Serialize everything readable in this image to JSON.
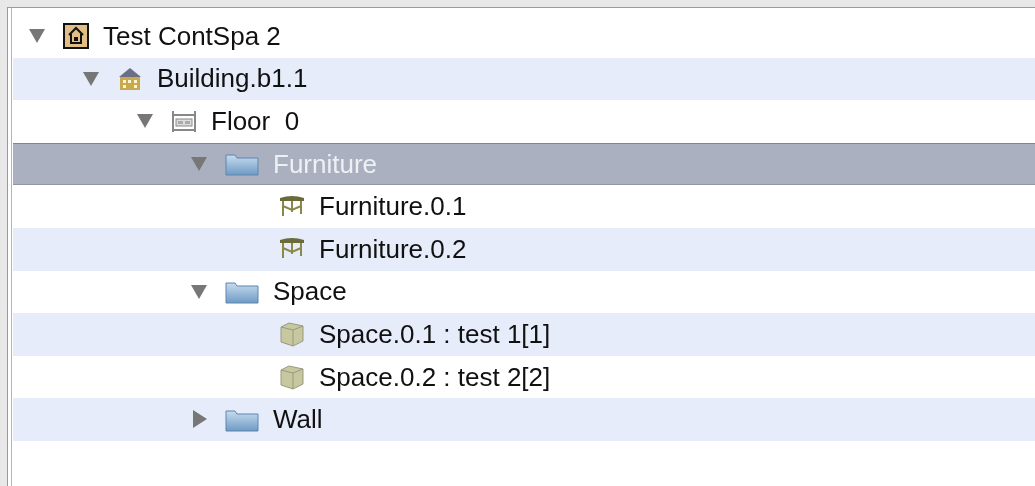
{
  "tree": [
    {
      "label": "Test ContSpa 2",
      "kind": "root",
      "expanded": true,
      "selected": false,
      "children": [
        {
          "label": "Building.b1.1",
          "kind": "building",
          "expanded": true,
          "selected": false,
          "children": [
            {
              "label": "Floor  0",
              "kind": "floor",
              "expanded": true,
              "selected": false,
              "children": [
                {
                  "label": "Furniture",
                  "kind": "folder",
                  "expanded": true,
                  "selected": true,
                  "children": [
                    {
                      "label": "Furniture.0.1",
                      "kind": "furniture",
                      "selected": false
                    },
                    {
                      "label": "Furniture.0.2",
                      "kind": "furniture",
                      "selected": false
                    }
                  ]
                },
                {
                  "label": "Space",
                  "kind": "folder",
                  "expanded": true,
                  "selected": false,
                  "children": [
                    {
                      "label": "Space.0.1 : test 1[1]",
                      "kind": "space",
                      "selected": false
                    },
                    {
                      "label": "Space.0.2 : test 2[2]",
                      "kind": "space",
                      "selected": false
                    }
                  ]
                },
                {
                  "label": "Wall",
                  "kind": "folder",
                  "expanded": false,
                  "selected": false
                }
              ]
            }
          ]
        }
      ]
    }
  ]
}
